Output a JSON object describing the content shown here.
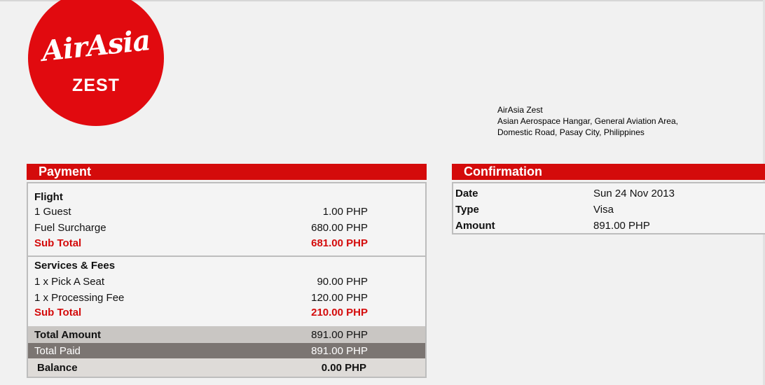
{
  "logo": {
    "main": "AirAsia",
    "sub": "ZEST"
  },
  "address": {
    "line1": "AirAsia Zest",
    "line2": "Asian Aerospace Hangar, General Aviation Area,",
    "line3": "Domestic Road, Pasay City, Philippines"
  },
  "payment": {
    "title": "Payment",
    "flight": {
      "heading": "Flight",
      "items": [
        {
          "label": "1 Guest",
          "value": "1.00 PHP"
        },
        {
          "label": "Fuel Surcharge",
          "value": "680.00 PHP"
        }
      ],
      "subtotal_label": "Sub Total",
      "subtotal_value": "681.00 PHP"
    },
    "services": {
      "heading": "Services & Fees",
      "items": [
        {
          "label": "1 x Pick A Seat",
          "value": "90.00 PHP"
        },
        {
          "label": "1 x Processing Fee",
          "value": "120.00 PHP"
        }
      ],
      "subtotal_label": "Sub Total",
      "subtotal_value": "210.00 PHP"
    },
    "total_amount_label": "Total Amount",
    "total_amount_value": "891.00 PHP",
    "total_paid_label": "Total Paid",
    "total_paid_value": "891.00 PHP",
    "balance_label": "Balance",
    "balance_value": "0.00 PHP"
  },
  "confirmation": {
    "title": "Confirmation",
    "rows": [
      {
        "label": "Date",
        "value": "Sun 24 Nov 2013"
      },
      {
        "label": "Type",
        "value": "Visa"
      },
      {
        "label": "Amount",
        "value": "891.00 PHP"
      }
    ]
  },
  "colors": {
    "brand_red": "#d40b0b",
    "logo_red": "#e10a0f",
    "paid_band": "#7b7572",
    "total_band": "#c9c6c3"
  }
}
